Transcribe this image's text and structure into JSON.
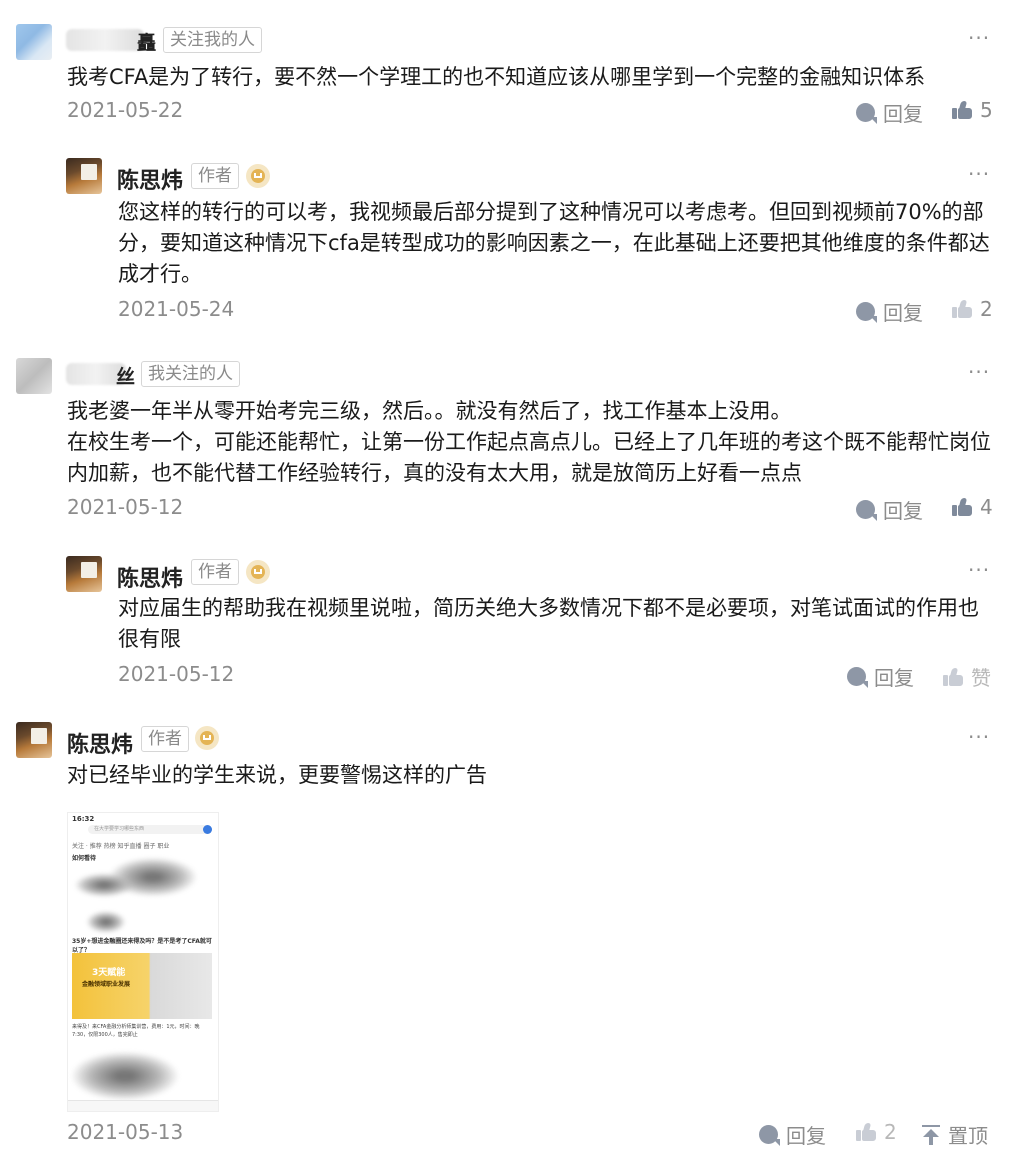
{
  "comments": [
    {
      "username_suffix": "矗",
      "tag": "关注我的人",
      "text": "我考CFA是为了转行，要不然一个学理工的也不知道应该从哪里学到一个完整的金融知识体系",
      "date": "2021-05-22",
      "reply_label": "回复",
      "like_count": "5"
    },
    {
      "username": "陈思炜",
      "tag": "作者",
      "text": "您这样的转行的可以考，我视频最后部分提到了这种情况可以考虑考。但回到视频前70%的部分，要知道这种情况下cfa是转型成功的影响因素之一，在此基础上还要把其他维度的条件都达成才行。",
      "date": "2021-05-24",
      "reply_label": "回复",
      "like_count": "2"
    },
    {
      "username_suffix": "丝",
      "tag": "我关注的人",
      "text_line1": "我老婆一年半从零开始考完三级，然后。。就没有然后了，找工作基本上没用。",
      "text_line2": "在校生考一个，可能还能帮忙，让第一份工作起点高点儿。已经上了几年班的考这个既不能帮忙岗位内加薪，也不能代替工作经验转行，真的没有太大用，就是放简历上好看一点点",
      "date": "2021-05-12",
      "reply_label": "回复",
      "like_count": "4"
    },
    {
      "username": "陈思炜",
      "tag": "作者",
      "text": "对应届生的帮助我在视频里说啦，简历关绝大多数情况下都不是必要项，对笔试面试的作用也很有限",
      "date": "2021-05-12",
      "reply_label": "回复",
      "like_label": "赞"
    },
    {
      "username": "陈思炜",
      "tag": "作者",
      "text": "对已经毕业的学生来说，更要警惕这样的广告",
      "date": "2021-05-13",
      "reply_label": "回复",
      "like_count": "2",
      "pin_label": "置顶",
      "image": {
        "status_time": "16:32",
        "search_placeholder": "在大学要学习哪些东西",
        "tabs": "关注 · 推荐   热榜   知乎直播   圈子   职业",
        "post_title": "如何看待",
        "card_title": "35岁+想进金融圈还来得及吗？是不是考了CFA就可以了？",
        "banner_title": "3天赋能",
        "banner_subtitle": "金融领域职业发展",
        "description": "来得及！来CFA金融分析师集训营，费用：1元，时间：晚7:30，仅限300人，售完即止"
      }
    }
  ],
  "icon_colors": {
    "liked": "#7f8a9b",
    "unliked": "#c9cdd5",
    "secondary_text": "#8c8c8c",
    "author_badge": "#e4b455"
  }
}
